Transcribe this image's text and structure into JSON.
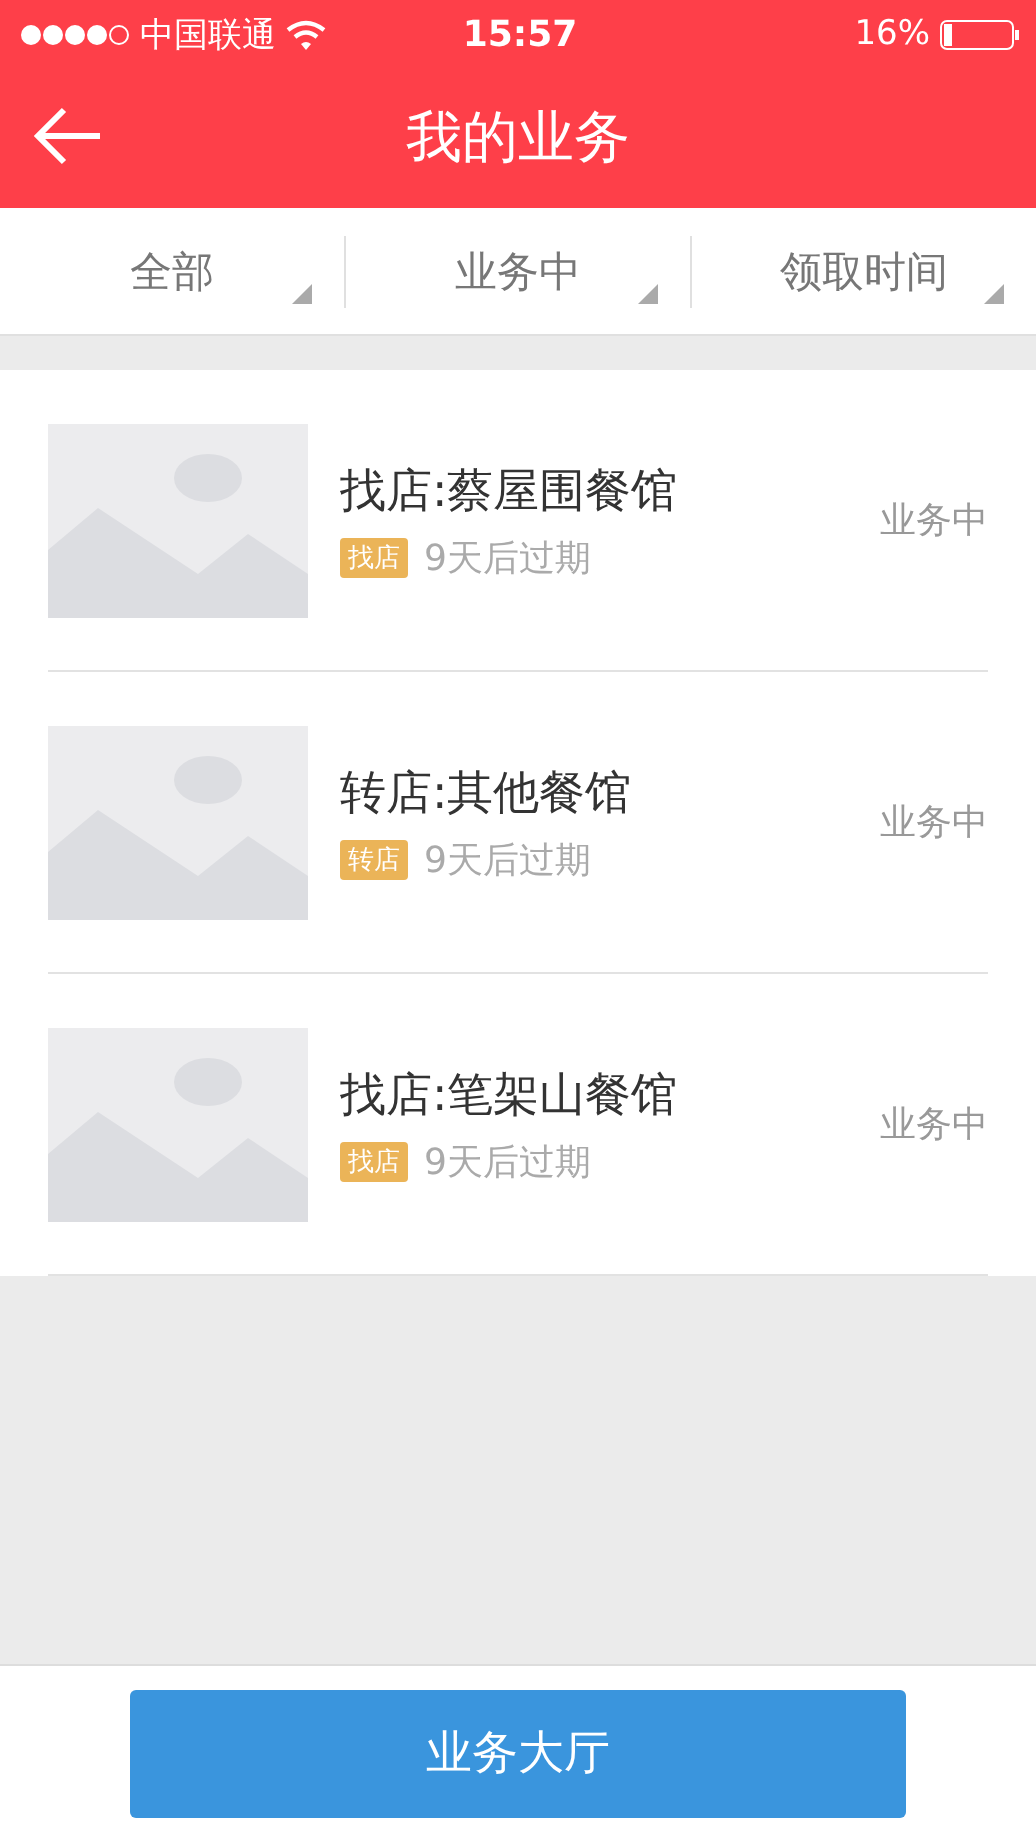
{
  "status_bar": {
    "carrier": "中国联通",
    "time": "15:57",
    "battery": "16%"
  },
  "header": {
    "title": "我的业务"
  },
  "filters": [
    {
      "label": "全部"
    },
    {
      "label": "业务中"
    },
    {
      "label": "领取时间"
    }
  ],
  "items": [
    {
      "title": "找店:蔡屋围餐馆",
      "tag": "找店",
      "expiry": "9天后过期",
      "status": "业务中"
    },
    {
      "title": "转店:其他餐馆",
      "tag": "转店",
      "expiry": "9天后过期",
      "status": "业务中"
    },
    {
      "title": "找店:笔架山餐馆",
      "tag": "找店",
      "expiry": "9天后过期",
      "status": "业务中"
    }
  ],
  "bottom_button": "业务大厅"
}
